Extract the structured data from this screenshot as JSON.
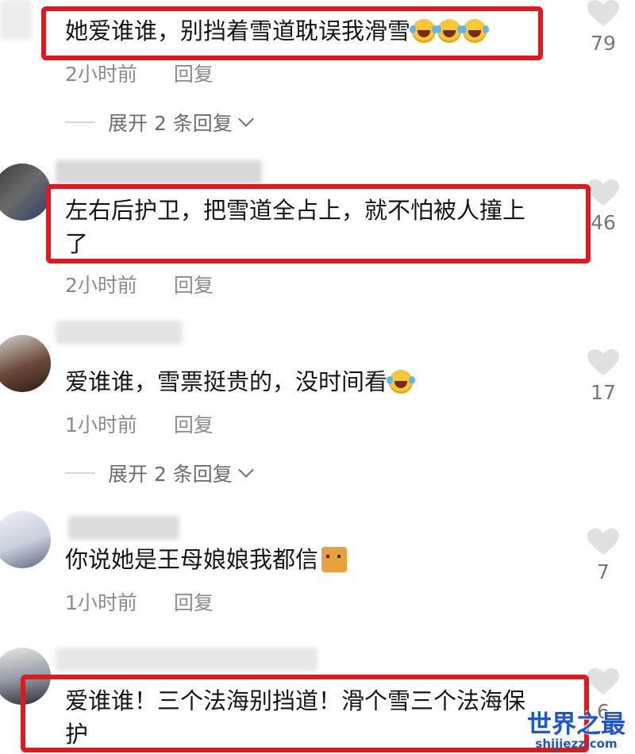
{
  "comments": [
    {
      "text": "她爱谁谁，别挡着雪道耽误我滑雪",
      "emoji": [
        "laugh-cry-emoji",
        "laugh-cry-emoji",
        "laugh-cry-emoji"
      ],
      "time": "2小时前",
      "reply": "回复",
      "likes": "79",
      "expand": "展开 2 条回复"
    },
    {
      "text_line1": "左右后护卫，把雪道全占上，就不怕被人撞上",
      "text_line2": "了",
      "time": "2小时前",
      "reply": "回复",
      "likes": "46"
    },
    {
      "text": "爱谁谁，雪票挺贵的，没时间看",
      "emoji": [
        "laugh-cry-emoji"
      ],
      "time": "1小时前",
      "reply": "回复",
      "likes": "17",
      "expand": "展开 2 条回复"
    },
    {
      "text": "你说她是王母娘娘我都信",
      "emoji": [
        "cat-emoji"
      ],
      "time": "1小时前",
      "reply": "回复",
      "likes": "7"
    },
    {
      "text_line1": "爱谁谁！三个法海别挡道！滑个雪三个法海保",
      "text_line2": "护",
      "likes": "6"
    }
  ],
  "watermark": {
    "main": "世界之最",
    "sub": "shijiezz.com"
  },
  "colors": {
    "highlight_box": "#e0191d",
    "meta_text": "#8b8b8b",
    "watermark": "#1f56c8"
  }
}
